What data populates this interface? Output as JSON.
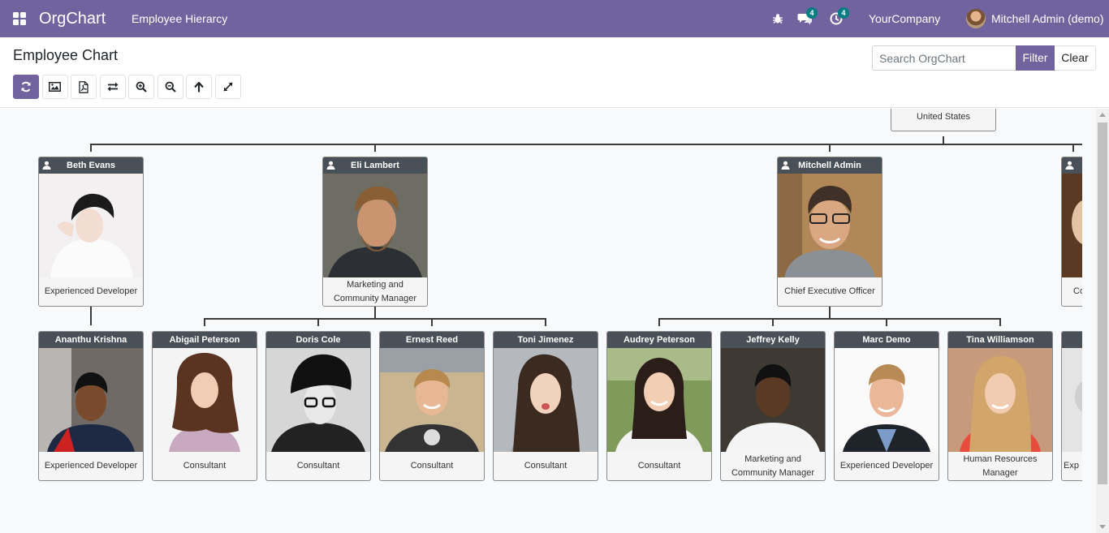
{
  "navbar": {
    "brand": "OrgChart",
    "menu": "Employee Hierarcy",
    "messages_count": "4",
    "activities_count": "4",
    "company": "YourCompany",
    "user": "Mitchell Admin (demo)",
    "accent": "#71639e",
    "icons": [
      "apps-grid-icon",
      "bug-icon",
      "chat-icon",
      "clock-icon"
    ]
  },
  "control_panel": {
    "title": "Employee Chart",
    "search_placeholder": "Search OrgChart",
    "filter_label": "Filter",
    "clear_label": "Clear",
    "toolbar_icons": [
      "refresh-icon",
      "image-export-icon",
      "pdf-export-icon",
      "swap-direction-icon",
      "zoom-in-icon",
      "zoom-out-icon",
      "go-up-icon",
      "fullscreen-icon"
    ]
  },
  "chart": {
    "root_label": "United States",
    "level1": [
      {
        "name": "Beth Evans",
        "job": "Experienced Developer",
        "icon": "user-icon"
      },
      {
        "name": "Eli Lambert",
        "job": "Marketing and Community Manager",
        "icon": "user-icon"
      },
      {
        "name": "Mitchell Admin",
        "job": "Chief Executive Officer",
        "icon": "user-icon"
      },
      {
        "name": "",
        "job": "Co",
        "icon": "user-icon"
      }
    ],
    "level2": [
      {
        "name": "Ananthu Krishna",
        "job": "Experienced Developer"
      },
      {
        "name": "Abigail Peterson",
        "job": "Consultant"
      },
      {
        "name": "Doris Cole",
        "job": "Consultant"
      },
      {
        "name": "Ernest Reed",
        "job": "Consultant"
      },
      {
        "name": "Toni Jimenez",
        "job": "Consultant"
      },
      {
        "name": "Audrey Peterson",
        "job": "Consultant"
      },
      {
        "name": "Jeffrey Kelly",
        "job": "Marketing and Community Manager"
      },
      {
        "name": "Marc Demo",
        "job": "Experienced Developer"
      },
      {
        "name": "Tina Williamson",
        "job": "Human Resources Manager"
      },
      {
        "name": "",
        "job": "Exp"
      }
    ]
  }
}
